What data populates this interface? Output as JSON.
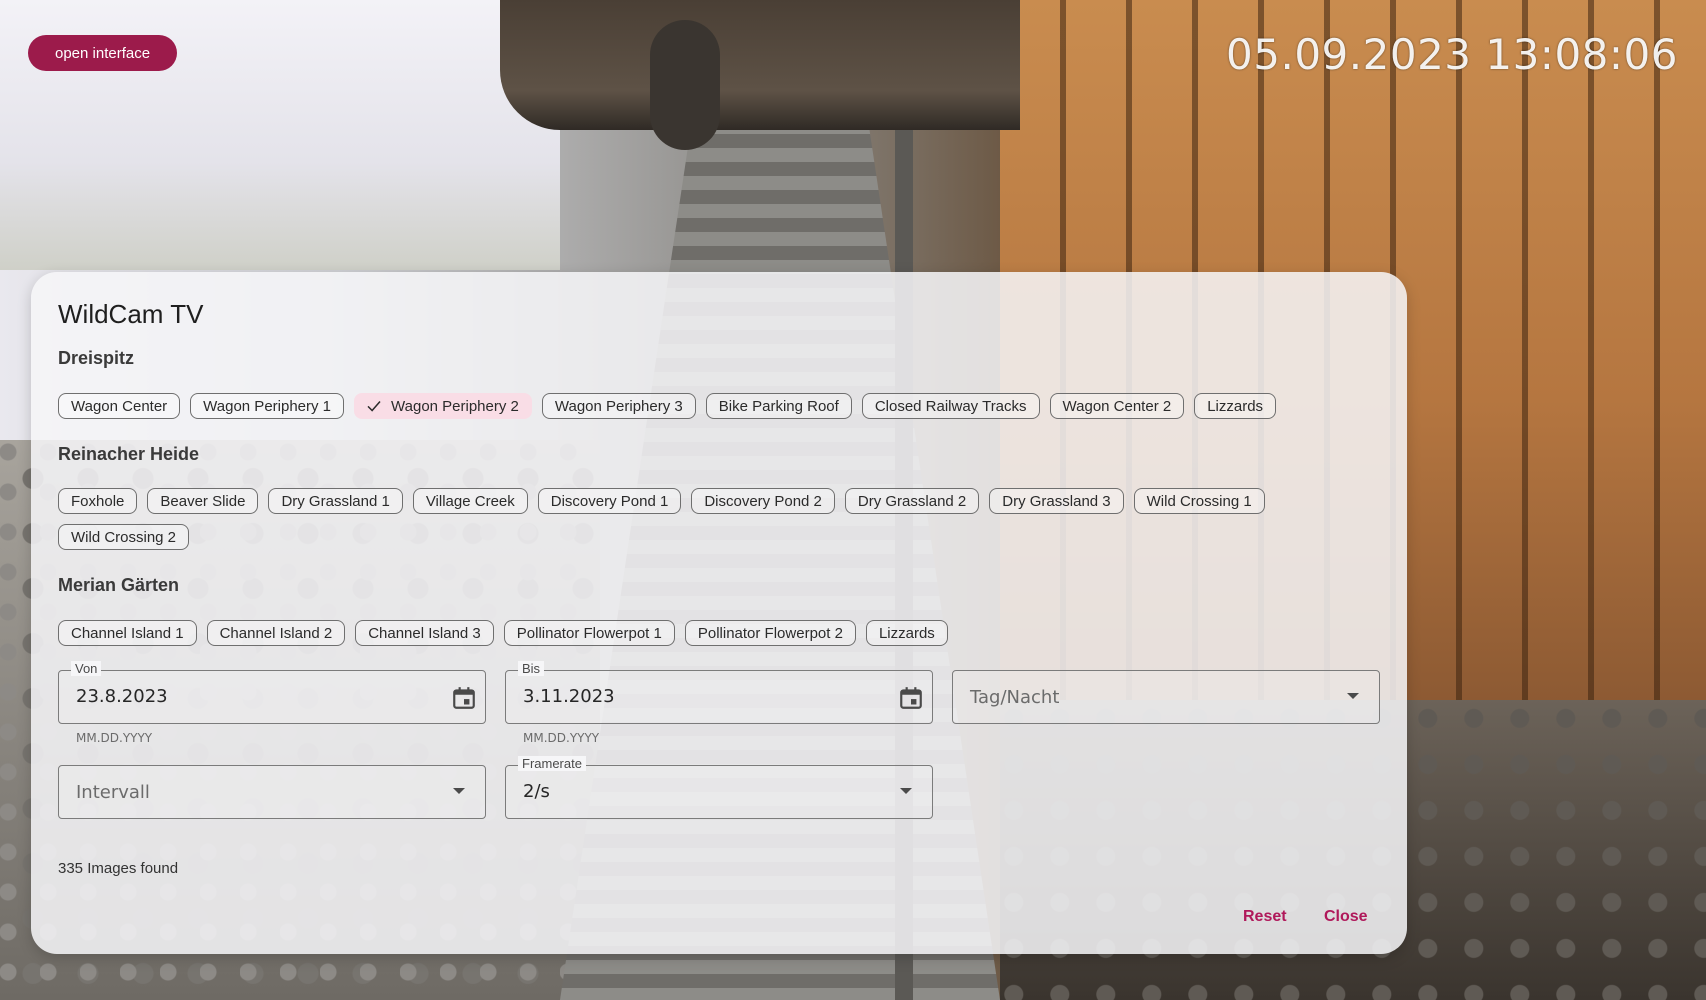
{
  "top_bar": {
    "open_interface_label": "open interface",
    "timestamp": "05.09.2023 13:08:06"
  },
  "panel": {
    "title": "WildCam TV",
    "groups": [
      {
        "title": "Dreispitz",
        "chips": [
          {
            "label": "Wagon Center",
            "selected": false
          },
          {
            "label": "Wagon Periphery 1",
            "selected": false
          },
          {
            "label": "Wagon Periphery 2",
            "selected": true
          },
          {
            "label": "Wagon Periphery 3",
            "selected": false
          },
          {
            "label": "Bike Parking Roof",
            "selected": false
          },
          {
            "label": "Closed Railway Tracks",
            "selected": false
          },
          {
            "label": "Wagon Center 2",
            "selected": false
          },
          {
            "label": "Lizzards",
            "selected": false
          }
        ]
      },
      {
        "title": "Reinacher Heide",
        "chips": [
          {
            "label": "Foxhole",
            "selected": false
          },
          {
            "label": "Beaver Slide",
            "selected": false
          },
          {
            "label": "Dry Grassland 1",
            "selected": false
          },
          {
            "label": "Village Creek",
            "selected": false
          },
          {
            "label": "Discovery Pond 1",
            "selected": false
          },
          {
            "label": "Discovery Pond 2",
            "selected": false
          },
          {
            "label": "Dry Grassland 2",
            "selected": false
          },
          {
            "label": "Dry Grassland 3",
            "selected": false
          },
          {
            "label": "Wild Crossing 1",
            "selected": false
          },
          {
            "label": "Wild Crossing 2",
            "selected": false
          }
        ]
      },
      {
        "title": "Merian Gärten",
        "chips": [
          {
            "label": "Channel Island 1",
            "selected": false
          },
          {
            "label": "Channel Island 2",
            "selected": false
          },
          {
            "label": "Channel Island 3",
            "selected": false
          },
          {
            "label": "Pollinator Flowerpot 1",
            "selected": false
          },
          {
            "label": "Pollinator Flowerpot 2",
            "selected": false
          },
          {
            "label": "Lizzards",
            "selected": false
          }
        ]
      }
    ],
    "fields": {
      "von": {
        "label": "Von",
        "value": "23.8.2023",
        "hint": "MM.DD.YYYY",
        "icon": "calendar-icon"
      },
      "bis": {
        "label": "Bis",
        "value": "3.11.2023",
        "hint": "MM.DD.YYYY",
        "icon": "calendar-icon"
      },
      "tag_nacht": {
        "placeholder": "Tag/Nacht"
      },
      "intervall": {
        "placeholder": "Intervall"
      },
      "framerate": {
        "label": "Framerate",
        "value": "2/s"
      }
    },
    "images_found": "335 Images found",
    "buttons": {
      "reset": "Reset",
      "close": "Close"
    }
  },
  "colors": {
    "accent": "#9c1b4b",
    "action_text": "#b0185a",
    "selected_chip": "#f9dde6"
  }
}
